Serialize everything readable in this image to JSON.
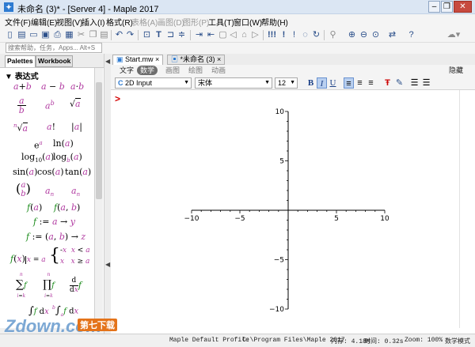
{
  "window": {
    "title": "未命名 (3)* - [Server 4] - Maple 2017",
    "app_icon": "maple-leaf-icon",
    "buttons": [
      "minimize",
      "restore",
      "close"
    ]
  },
  "menu": {
    "items": [
      {
        "label": "文件(F)",
        "enabled": true
      },
      {
        "label": "编辑(E)",
        "enabled": true
      },
      {
        "label": "视图(V)",
        "enabled": true
      },
      {
        "label": "插入(I)",
        "enabled": true
      },
      {
        "label": "格式(R)",
        "enabled": true
      },
      {
        "label": "表格(A)",
        "enabled": false
      },
      {
        "label": "画图(D)",
        "enabled": false
      },
      {
        "label": "图形(P)",
        "enabled": false
      },
      {
        "label": "工具(T)",
        "enabled": true
      },
      {
        "label": "窗口(W)",
        "enabled": true
      },
      {
        "label": "帮助(H)",
        "enabled": true
      }
    ]
  },
  "toolbar_icons": [
    "new-document-icon",
    "new-worksheet-icon",
    "open-icon",
    "save-icon",
    "print-icon",
    "print-preview-icon",
    "cut-icon",
    "copy-icon",
    "paste-icon",
    "undo-icon",
    "redo-icon",
    "insert-math-icon",
    "text-mode-icon",
    "insert-prompt-icon",
    "indent-icon",
    "outdent-icon",
    "stop-icon",
    "back-icon",
    "forward-icon",
    "execute-icon",
    "execute-all-icon",
    "debug-icon",
    "interrupt-icon",
    "restart-icon",
    "link-icon",
    "zoom-in-icon",
    "zoom-out-icon",
    "zoom-reset-icon",
    "toggle-icon",
    "help-icon",
    "cloud-icon"
  ],
  "search": {
    "placeholder": "搜索帮助，任务，Apps... Alt+S"
  },
  "left_panel": {
    "tabs": [
      {
        "label": "Palettes",
        "active": true
      },
      {
        "label": "Workbook",
        "active": false
      }
    ],
    "palette_header": "表达式",
    "palette_rows": [
      [
        "a+b",
        "a−b",
        "a·b"
      ],
      [
        "a/b",
        "a^b",
        "√a"
      ],
      [
        "ⁿ√a",
        "a!",
        "|a|"
      ],
      [
        "eᵃ",
        "ln(a)"
      ],
      [
        "log₁₀(a)",
        "log_b(a)"
      ],
      [
        "sin(a)",
        "cos(a)",
        "tan(a)"
      ],
      [
        "(a b)",
        "aₙ",
        "aₙ"
      ],
      [
        "f(a)",
        "f(a,b)"
      ],
      [
        "f:=a→y"
      ],
      [
        "f:=(a,b)→z"
      ],
      [
        "f(x)|x=a",
        "{-x x<a ; x x≥a"
      ],
      [
        "Σ f",
        "Π f",
        "d/dx f"
      ],
      [
        "∫ f dx",
        "∫ₐᵇ f dx"
      ]
    ]
  },
  "doc_tabs": [
    {
      "label": "Start.mw",
      "active": true,
      "close": "×"
    },
    {
      "label": "*未命名 (3)",
      "active": false,
      "close": "×"
    }
  ],
  "context_bar": {
    "modes": [
      {
        "label": "文字",
        "selected": false
      },
      {
        "label": "数学",
        "selected": true
      },
      {
        "label": "画图",
        "selected": false
      },
      {
        "label": "绘图",
        "selected": false
      },
      {
        "label": "动画",
        "selected": false
      }
    ],
    "hide_label": "隐藏"
  },
  "format_bar": {
    "input_mode_icon": "C",
    "input_mode": "2D Input",
    "font": "宋体",
    "size": "12",
    "bold": "B",
    "italic": "I",
    "underline": "U",
    "buttons": [
      "align-left-icon",
      "align-center-icon",
      "align-right-icon",
      "text-color-icon",
      "highlight-icon",
      "bullet-list-icon",
      "numbered-list-icon"
    ]
  },
  "document": {
    "prompt": ">"
  },
  "chart_data": {
    "type": "line",
    "title": "",
    "xlabel": "",
    "ylabel": "",
    "xlim": [
      -10,
      10
    ],
    "ylim": [
      -10,
      10
    ],
    "x_ticks": [
      -10,
      -5,
      5,
      10
    ],
    "y_ticks": [
      -10,
      -5,
      5,
      10
    ],
    "x_tick_labels": [
      "−10",
      "−5",
      "5",
      "10"
    ],
    "y_tick_labels": [
      "−10",
      "−5",
      "5",
      "10"
    ],
    "grid": false,
    "series": []
  },
  "status_bar": {
    "profile": "Maple Default Profile",
    "path": "C:\\Program Files\\Maple 2017",
    "memory": "内存: 4.18M",
    "time": "时间: 0.32s",
    "zoom": "Zoom: 100%",
    "mode": "数学模式"
  },
  "watermark": {
    "text": "Zdown.com",
    "badge": "第七下载"
  },
  "colors": {
    "accent": "#2e7bd1",
    "palette_placeholder": "#b13aa1",
    "palette_variable": "#1c8c1c",
    "prompt": "#d40000"
  }
}
